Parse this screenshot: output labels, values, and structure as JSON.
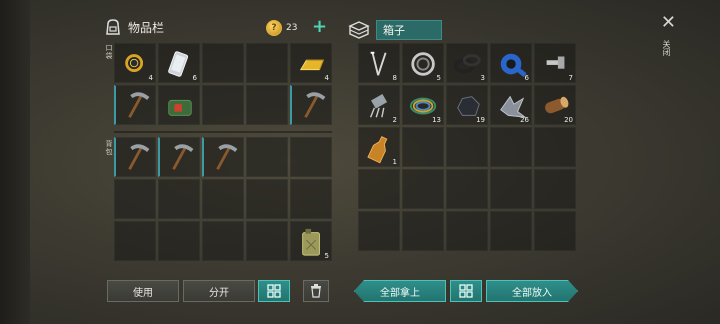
{
  "inventory": {
    "title": "物品栏",
    "coins": "23",
    "add_label": "+",
    "pocket_label": "口袋",
    "backpack_label": "背包",
    "slots_top": [
      {
        "item": "gold-watch",
        "count": "4"
      },
      {
        "item": "smartphone",
        "count": "6"
      },
      {
        "item": "",
        "count": ""
      },
      {
        "item": "",
        "count": ""
      },
      {
        "item": "gold-bar",
        "count": "4"
      },
      {
        "item": "pickaxe",
        "count": ""
      },
      {
        "item": "green-bag",
        "count": ""
      },
      {
        "item": "",
        "count": ""
      },
      {
        "item": "",
        "count": ""
      },
      {
        "item": "pickaxe",
        "count": ""
      }
    ],
    "slots_backpack": [
      {
        "item": "pickaxe",
        "count": ""
      },
      {
        "item": "pickaxe",
        "count": ""
      },
      {
        "item": "pickaxe",
        "count": ""
      },
      {
        "item": "",
        "count": ""
      },
      {
        "item": "",
        "count": ""
      },
      {
        "item": "",
        "count": ""
      },
      {
        "item": "",
        "count": ""
      },
      {
        "item": "",
        "count": ""
      },
      {
        "item": "",
        "count": ""
      },
      {
        "item": "",
        "count": ""
      },
      {
        "item": "",
        "count": ""
      },
      {
        "item": "",
        "count": ""
      },
      {
        "item": "",
        "count": ""
      },
      {
        "item": "",
        "count": ""
      },
      {
        "item": "jerrycan",
        "count": "5"
      }
    ],
    "buttons": {
      "use": "使用",
      "split": "分开"
    }
  },
  "box": {
    "title": "箱子",
    "slots": [
      {
        "item": "nails",
        "count": "8"
      },
      {
        "item": "bearing",
        "count": "5"
      },
      {
        "item": "rubber-rings",
        "count": "3"
      },
      {
        "item": "blue-tape",
        "count": "6"
      },
      {
        "item": "bolt",
        "count": "7"
      },
      {
        "item": "electronic-part",
        "count": "2"
      },
      {
        "item": "wire-coil",
        "count": "13"
      },
      {
        "item": "coal",
        "count": "19"
      },
      {
        "item": "scrap-metal",
        "count": "26"
      },
      {
        "item": "log",
        "count": "20"
      },
      {
        "item": "bottle",
        "count": "1"
      }
    ],
    "buttons": {
      "take_all": "全部拿上",
      "put_all": "全部放入"
    }
  },
  "close_label": "关闭",
  "colors": {
    "accent": "#2f8f8a",
    "equipped": "#3c9aa4"
  }
}
